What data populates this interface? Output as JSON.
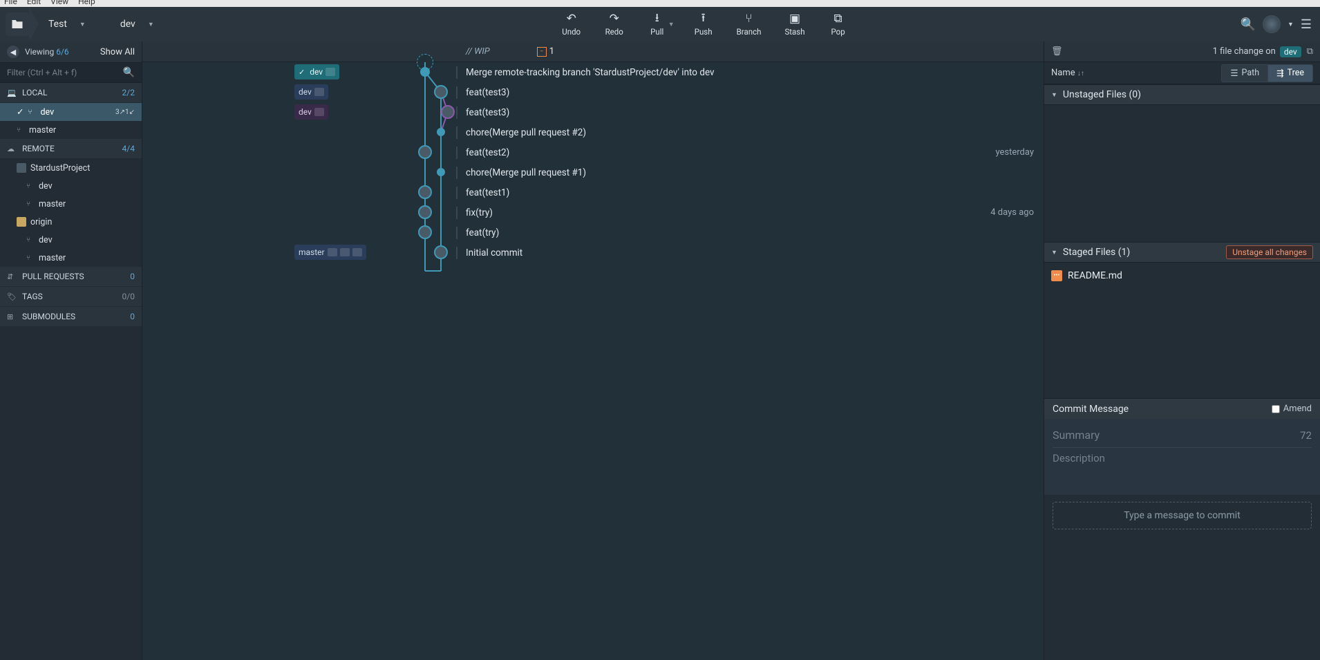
{
  "menubar": [
    "File",
    "Edit",
    "View",
    "Help"
  ],
  "breadcrumb": {
    "repo": "Test",
    "branch": "dev"
  },
  "toolbar": {
    "undo": "Undo",
    "redo": "Redo",
    "pull": "Pull",
    "push": "Push",
    "branch": "Branch",
    "stash": "Stash",
    "pop": "Pop"
  },
  "sidebar": {
    "viewing_label": "Viewing",
    "viewing_count": "6/6",
    "show_all": "Show All",
    "filter_placeholder": "Filter (Ctrl + Alt + f)",
    "sections": {
      "local": {
        "label": "LOCAL",
        "count": "2/2"
      },
      "remote": {
        "label": "REMOTE",
        "count": "4/4"
      },
      "pull_requests": {
        "label": "PULL REQUESTS",
        "count": "0"
      },
      "tags": {
        "label": "TAGS",
        "count": "0/0"
      },
      "submodules": {
        "label": "SUBMODULES",
        "count": "0"
      }
    },
    "local_branches": [
      {
        "name": "dev",
        "active": true,
        "indicator": "3↗1↙"
      },
      {
        "name": "master"
      }
    ],
    "remotes": [
      {
        "name": "StardustProject",
        "branches": [
          "dev",
          "master"
        ]
      },
      {
        "name": "origin",
        "branches": [
          "dev",
          "master"
        ]
      }
    ]
  },
  "graph": {
    "wip_label": "// WIP",
    "wip_count": "1",
    "commits": [
      {
        "branch_tag": "dev",
        "tag_style": "bt-dev",
        "tag_check": true,
        "msg": "Merge remote-tracking branch 'StardustProject/dev' into dev"
      },
      {
        "branch_tag": "dev",
        "tag_style": "bt-dev2",
        "msg": "feat(test3)"
      },
      {
        "branch_tag": "dev",
        "tag_style": "bt-dev3",
        "msg": "feat(test3)"
      },
      {
        "msg": "chore(Merge pull request #2)"
      },
      {
        "msg": "feat(test2)",
        "time": "yesterday"
      },
      {
        "msg": "chore(Merge pull request #1)"
      },
      {
        "msg": "feat(test1)"
      },
      {
        "msg": "fix(try)",
        "time": "4 days ago"
      },
      {
        "msg": "feat(try)"
      },
      {
        "branch_tag": "master",
        "tag_style": "bt-master",
        "tag_extra": true,
        "msg": "Initial commit"
      }
    ]
  },
  "rightpanel": {
    "file_change_label": "1 file change on",
    "branch": "dev",
    "name_label": "Name",
    "path_label": "Path",
    "tree_label": "Tree",
    "unstaged_header": "Unstaged Files (0)",
    "staged_header": "Staged Files (1)",
    "unstage_all": "Unstage all changes",
    "staged_files": [
      {
        "name": "README.md"
      }
    ],
    "commit_message_label": "Commit Message",
    "amend_label": "Amend",
    "summary_placeholder": "Summary",
    "summary_count": "72",
    "description_placeholder": "Description",
    "commit_button": "Type a message to commit"
  }
}
